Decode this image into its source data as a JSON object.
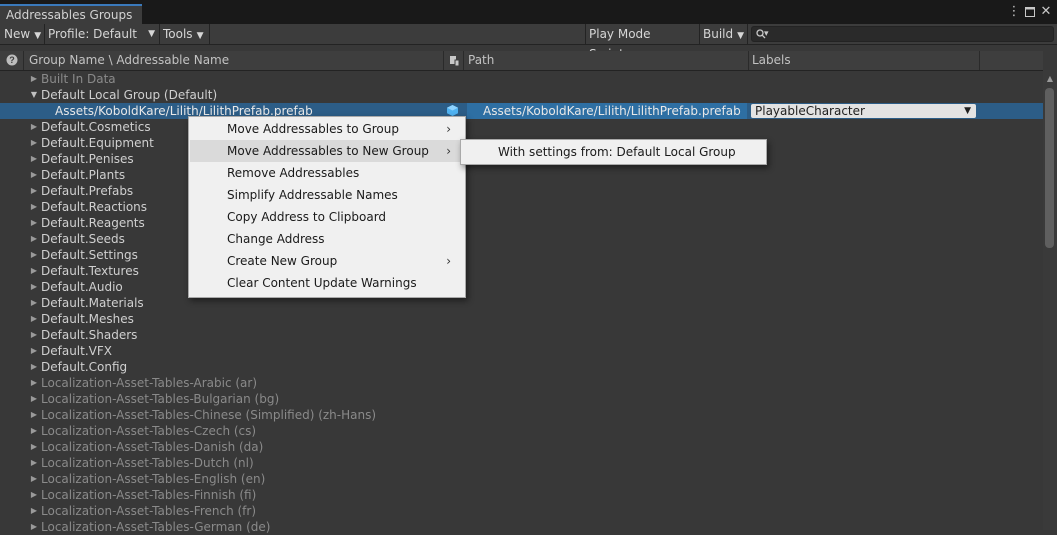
{
  "window": {
    "title": "Addressables Groups"
  },
  "toolbar": {
    "new_label": "New",
    "profile_label": "Profile: Default",
    "tools_label": "Tools",
    "play_mode_label": "Play Mode Script",
    "build_label": "Build",
    "search_placeholder": ""
  },
  "columns": {
    "name": "Group Name \\ Addressable Name",
    "path": "Path",
    "labels": "Labels"
  },
  "rows_before": [
    {
      "name": "Built In Data",
      "dim": true,
      "expanded": false
    }
  ],
  "expanded_group": {
    "name": "Default Local Group (Default)"
  },
  "selected_entry": {
    "name": "Assets/KoboldKare/Lilith/LilithPrefab.prefab",
    "path": "Assets/KoboldKare/Lilith/LilithPrefab.prefab",
    "label": "PlayableCharacter"
  },
  "rows_after": [
    "Default.Cosmetics",
    "Default.Equipment",
    "Default.Penises",
    "Default.Plants",
    "Default.Prefabs",
    "Default.Reactions",
    "Default.Reagents",
    "Default.Seeds",
    "Default.Settings",
    "Default.Textures",
    "Default.Audio",
    "Default.Materials",
    "Default.Meshes",
    "Default.Shaders",
    "Default.VFX",
    "Default.Config",
    "Localization-Asset-Tables-Arabic (ar)",
    "Localization-Asset-Tables-Bulgarian (bg)",
    "Localization-Asset-Tables-Chinese (Simplified) (zh-Hans)",
    "Localization-Asset-Tables-Czech (cs)",
    "Localization-Asset-Tables-Danish (da)",
    "Localization-Asset-Tables-Dutch (nl)",
    "Localization-Asset-Tables-English (en)",
    "Localization-Asset-Tables-Finnish (fi)",
    "Localization-Asset-Tables-French (fr)",
    "Localization-Asset-Tables-German (de)"
  ],
  "context_menu": {
    "items": [
      {
        "label": "Move Addressables to Group",
        "submenu": true
      },
      {
        "label": "Move Addressables to New Group",
        "submenu": true,
        "hover": true
      },
      {
        "label": "Remove Addressables",
        "submenu": false
      },
      {
        "label": "Simplify Addressable Names",
        "submenu": false
      },
      {
        "label": "Copy Address to Clipboard",
        "submenu": false
      },
      {
        "label": "Change Address",
        "submenu": false
      },
      {
        "label": "Create New Group",
        "submenu": true
      },
      {
        "label": "Clear Content Update Warnings",
        "submenu": false
      }
    ]
  },
  "submenu": {
    "item": "With settings from: Default Local Group"
  },
  "colors": {
    "background": "#383838",
    "selection": "#2c5d87",
    "menu_bg": "#f0f0f0",
    "menu_hover": "#dadada"
  }
}
